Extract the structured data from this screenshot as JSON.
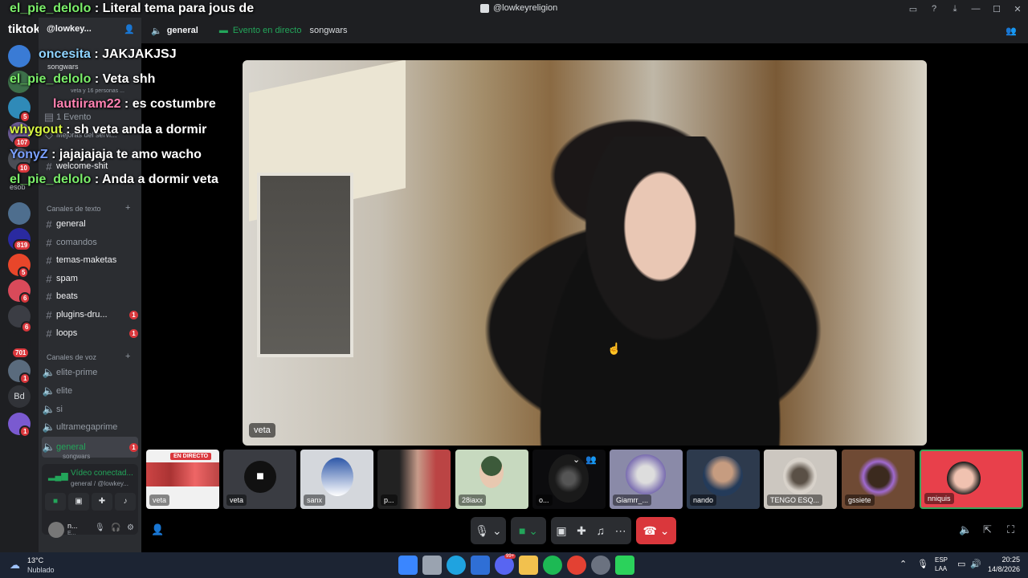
{
  "titlebar": {
    "title": "@lowkeyreligion",
    "buttons": [
      "▭",
      "?",
      "⤓",
      "—",
      "☐",
      "✕"
    ]
  },
  "server_rail": {
    "badges": [
      "5",
      "107",
      "10",
      "819",
      "5",
      "6",
      "6",
      "701",
      "1",
      "1"
    ],
    "bd_label": "Bd",
    "esob_label": "esob",
    "tiktok": "tiktok"
  },
  "sidebar": {
    "server_name": "@lowkey...",
    "event": "1 Evento",
    "mejoras": "Mejoras del servi...",
    "welcome": "welcome-shit",
    "voice_preview": "veta y 16 personas ...",
    "songwars": "songwars",
    "text_category": "Canales de texto",
    "text_channels": [
      {
        "name": "general",
        "badge": ""
      },
      {
        "name": "comandos",
        "badge": ""
      },
      {
        "name": "temas-maketas",
        "badge": ""
      },
      {
        "name": "spam",
        "badge": ""
      },
      {
        "name": "beats",
        "badge": ""
      },
      {
        "name": "plugins-dru...",
        "badge": "1"
      },
      {
        "name": "loops",
        "badge": "1"
      }
    ],
    "voice_category": "Canales de voz",
    "voice_channels": [
      {
        "name": "elite-prime",
        "badge": ""
      },
      {
        "name": "elite",
        "badge": ""
      },
      {
        "name": "si",
        "badge": ""
      },
      {
        "name": "ultramegaprime",
        "badge": ""
      },
      {
        "name": "general",
        "badge": "1",
        "sub": "songwars"
      }
    ],
    "voice_panel": {
      "status": "Vídeo conectad...",
      "sub": "general / @lowkey..."
    },
    "user_panel": {
      "name": "n...",
      "sub": "E..."
    }
  },
  "header": {
    "channel": "general",
    "event": "Evento en directo",
    "stage": "songwars"
  },
  "main_video": {
    "name": "veta"
  },
  "thumbnails": [
    {
      "label": "veta",
      "live": "EN DIRECTO"
    },
    {
      "label": "veta"
    },
    {
      "label": "sanx"
    },
    {
      "label": "p..."
    },
    {
      "label": "28iaxx"
    },
    {
      "label": "o..."
    },
    {
      "label": "Giamrr_..."
    },
    {
      "label": "nando"
    },
    {
      "label": "TENGO ESQ..."
    },
    {
      "label": "gssiete"
    },
    {
      "label": "nniquis"
    }
  ],
  "chat": [
    {
      "user": "el_pie_delolo",
      "msg": " : Literal tema para jous de",
      "color": "#7cf06b"
    },
    {
      "user": "oncesita",
      "msg": " : JAKJAKJSJ",
      "color": "#8fd4ff"
    },
    {
      "user": "el_pie_delolo",
      "msg": " : Veta shh",
      "color": "#7cf06b"
    },
    {
      "user": "lautiiram22",
      "msg": " : es costumbre",
      "color": "#ff82b2"
    },
    {
      "user": "whygout",
      "msg": " : sh veta anda a dormir",
      "color": "#d8f542"
    },
    {
      "user": "YonyZ",
      "msg": " : jajajajaja te amo wacho",
      "color": "#7aa0ff"
    },
    {
      "user": "el_pie_delolo",
      "msg": " : Anda a dormir veta",
      "color": "#7cf06b"
    }
  ],
  "taskbar": {
    "weather_temp": "13°C",
    "weather_desc": "Nublado",
    "lang1": "ESP",
    "lang2": "LAA",
    "time": "20:25",
    "date": "14/8/2026",
    "app_badge": "99+"
  },
  "colors": {
    "danger": "#da373c",
    "green": "#23a55a",
    "accent": "#5865f2"
  }
}
